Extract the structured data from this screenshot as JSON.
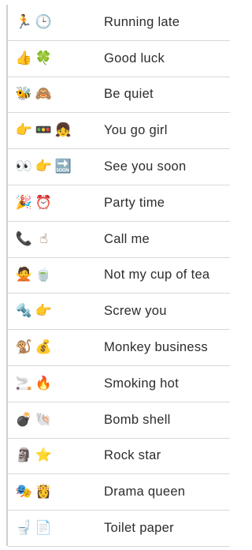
{
  "rows": [
    {
      "label": "Running late",
      "icons": [
        "running-person",
        "clock"
      ],
      "glyphs": [
        "🏃",
        "🕒"
      ]
    },
    {
      "label": "Good luck",
      "icons": [
        "thumbs-up",
        "four-leaf-clover"
      ],
      "glyphs": [
        "👍",
        "🍀"
      ]
    },
    {
      "label": "Be quiet",
      "icons": [
        "bee",
        "see-no-evil-monkey"
      ],
      "glyphs": [
        "🐝",
        "🙈"
      ]
    },
    {
      "label": "You go girl",
      "icons": [
        "pointing-right",
        "traffic-light",
        "girl"
      ],
      "glyphs": [
        "👉",
        "🚥",
        "👧"
      ]
    },
    {
      "label": "See you soon",
      "icons": [
        "eyes",
        "pointing-right",
        "soon-arrow"
      ],
      "glyphs": [
        "👀",
        "👉",
        "🔜"
      ]
    },
    {
      "label": "Party time",
      "icons": [
        "party-popper",
        "alarm-clock"
      ],
      "glyphs": [
        "🎉",
        "⏰"
      ]
    },
    {
      "label": "Call me",
      "icons": [
        "telephone-receiver",
        "pointing-up"
      ],
      "glyphs": [
        "📞",
        "☝"
      ]
    },
    {
      "label": "Not my cup of tea",
      "icons": [
        "no-gesture-woman",
        "teacup"
      ],
      "glyphs": [
        "🙅",
        "🍵"
      ]
    },
    {
      "label": "Screw you",
      "icons": [
        "screw-nut",
        "pointing-right"
      ],
      "glyphs": [
        "🔩",
        "👉"
      ]
    },
    {
      "label": "Monkey business",
      "icons": [
        "monkey",
        "money-bag"
      ],
      "glyphs": [
        "🐒",
        "💰"
      ]
    },
    {
      "label": "Smoking hot",
      "icons": [
        "cigarette",
        "fire"
      ],
      "glyphs": [
        "🚬",
        "🔥"
      ]
    },
    {
      "label": "Bomb shell",
      "icons": [
        "bomb",
        "spiral-shell"
      ],
      "glyphs": [
        "💣",
        "🐚"
      ]
    },
    {
      "label": "Rock star",
      "icons": [
        "moai",
        "star"
      ],
      "glyphs": [
        "🗿",
        "⭐"
      ]
    },
    {
      "label": "Drama queen",
      "icons": [
        "performing-arts",
        "princess"
      ],
      "glyphs": [
        "🎭",
        "👸"
      ]
    },
    {
      "label": "Toilet paper",
      "icons": [
        "toilet",
        "page"
      ],
      "glyphs": [
        "🚽",
        "📄"
      ]
    }
  ]
}
